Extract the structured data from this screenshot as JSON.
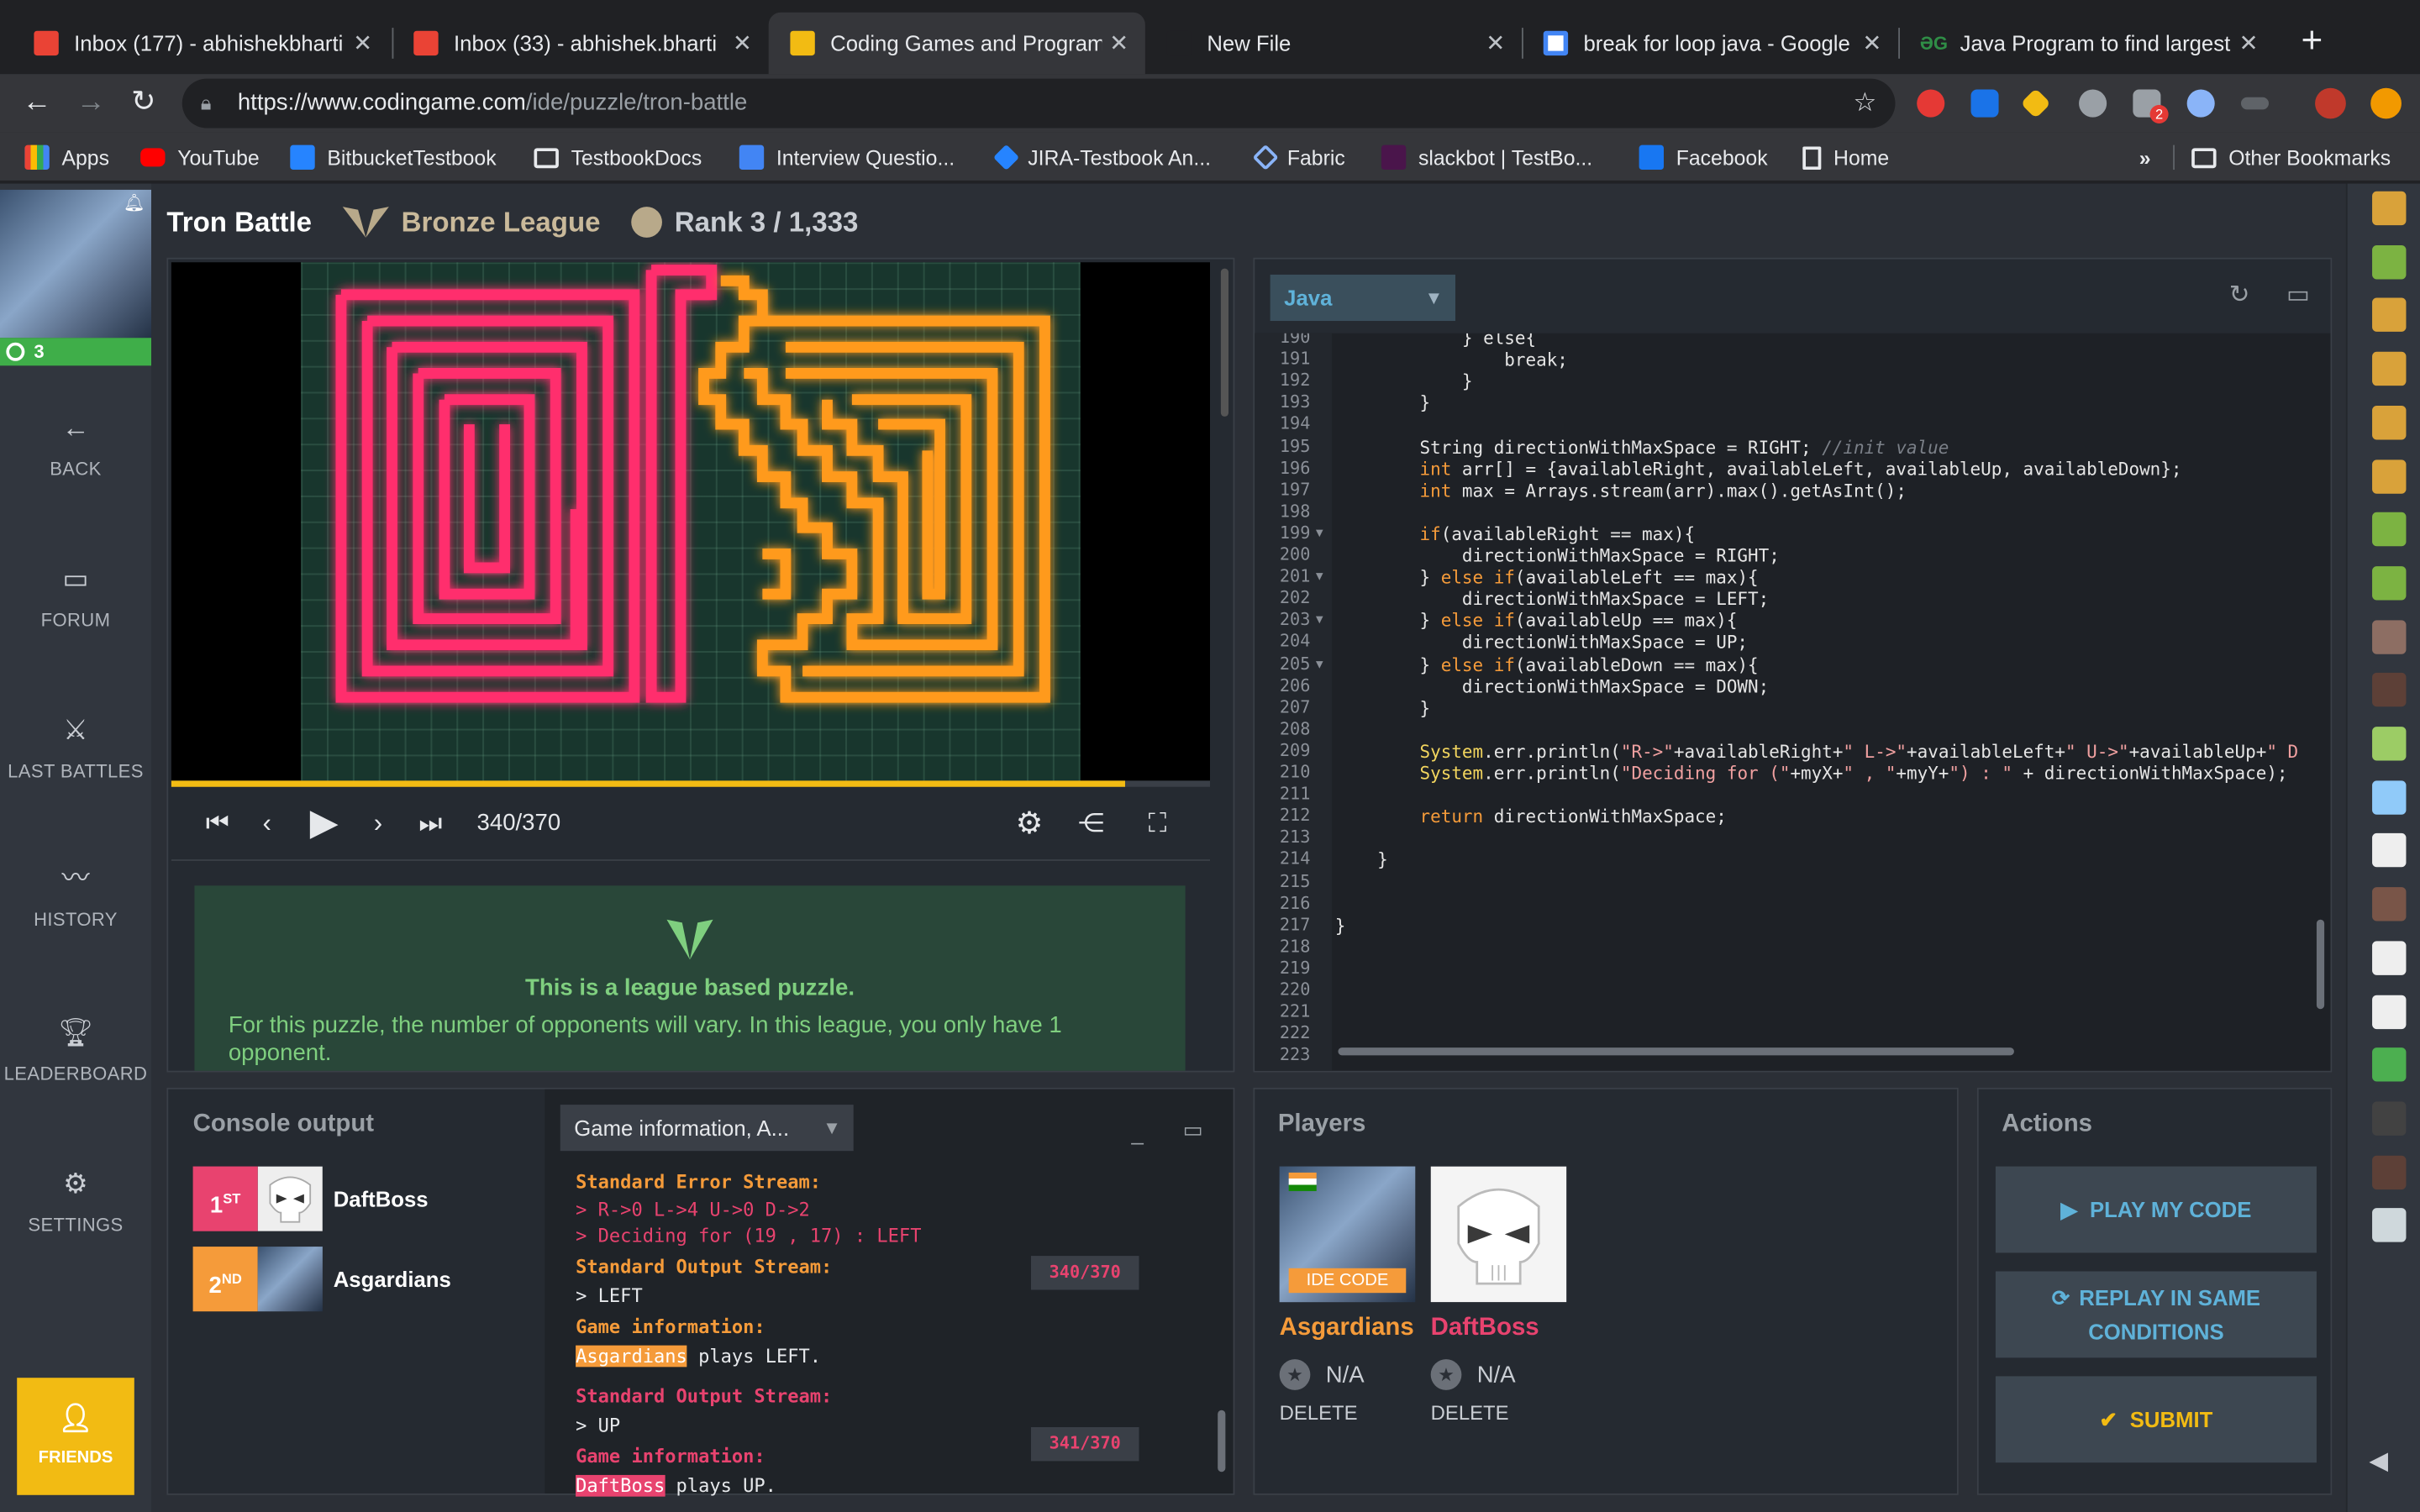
{
  "browser": {
    "tabs": [
      {
        "title": "Inbox (177) - abhishekbharti",
        "active": false,
        "icon": "gmail-icon"
      },
      {
        "title": "Inbox (33) - abhishek.bharti",
        "active": false,
        "icon": "gmail-icon"
      },
      {
        "title": "Coding Games and Programm",
        "active": true,
        "icon": "codingame-icon"
      },
      {
        "title": "New File",
        "active": false,
        "icon": "file-icon"
      },
      {
        "title": "break for loop java - Google",
        "active": false,
        "icon": "google-icon"
      },
      {
        "title": "Java Program to find largest",
        "active": false,
        "icon": "gfg-icon"
      }
    ],
    "url_host": "https://www.codingame.com",
    "url_path": "/ide/puzzle/tron-battle",
    "bookmarks": [
      "Apps",
      "YouTube",
      "BitbucketTestbook",
      "TestbookDocs",
      "Interview Questio...",
      "JIRA-Testbook An...",
      "Fabric",
      "slackbot | TestBo...",
      "Facebook",
      "Home"
    ],
    "more_bookmarks": "»",
    "other_bookmarks": "Other Bookmarks",
    "extension_badge": "2"
  },
  "nav": {
    "level": "3",
    "items": [
      "BACK",
      "FORUM",
      "LAST BATTLES",
      "HISTORY",
      "LEADERBOARD",
      "SETTINGS"
    ],
    "friends": "FRIENDS"
  },
  "header": {
    "title": "Tron Battle",
    "league": "Bronze League",
    "rank": "Rank 3 / 1,333"
  },
  "viewer": {
    "frame": "340/370",
    "progress": 0.919,
    "notice_title": "This is a league based puzzle.",
    "notice_text": "For this puzzle, the number of opponents will vary. In this league, you only have 1 opponent."
  },
  "editor": {
    "language": "Java",
    "line_numbers": [
      "190",
      "191",
      "192",
      "193",
      "194",
      "195",
      "196",
      "197",
      "198",
      "199",
      "200",
      "201",
      "202",
      "203",
      "204",
      "205",
      "206",
      "207",
      "208",
      "209",
      "210",
      "211",
      "212",
      "213",
      "214",
      "215",
      "216",
      "217",
      "218",
      "219",
      "220",
      "221",
      "222",
      "223"
    ],
    "folds": [
      "199",
      "201",
      "203",
      "205"
    ],
    "lines": [
      [
        [
          "white",
          "            } else{"
        ]
      ],
      [
        [
          "white",
          "                break;"
        ]
      ],
      [
        [
          "white",
          "            }"
        ]
      ],
      [
        [
          "white",
          "        }"
        ]
      ],
      [
        [
          "white",
          ""
        ]
      ],
      [
        [
          "white",
          "        String directionWithMaxSpace = RIGHT; "
        ],
        [
          "cm",
          "//init value"
        ]
      ],
      [
        [
          "kw",
          "        int"
        ],
        [
          "white",
          " arr[] = {availableRight, availableLeft, availableUp, availableDown};"
        ]
      ],
      [
        [
          "kw",
          "        int"
        ],
        [
          "white",
          " max = Arrays.stream(arr).max().getAsInt();"
        ]
      ],
      [
        [
          "white",
          ""
        ]
      ],
      [
        [
          "kw",
          "        if"
        ],
        [
          "white",
          "(availableRight == max){"
        ]
      ],
      [
        [
          "white",
          "            directionWithMaxSpace = RIGHT;"
        ]
      ],
      [
        [
          "white",
          "        } "
        ],
        [
          "kw",
          "else if"
        ],
        [
          "white",
          "(availableLeft == max){"
        ]
      ],
      [
        [
          "white",
          "            directionWithMaxSpace = LEFT;"
        ]
      ],
      [
        [
          "white",
          "        } "
        ],
        [
          "kw",
          "else if"
        ],
        [
          "white",
          "(availableUp == max){"
        ]
      ],
      [
        [
          "white",
          "            directionWithMaxSpace = UP;"
        ]
      ],
      [
        [
          "white",
          "        } "
        ],
        [
          "kw",
          "else if"
        ],
        [
          "white",
          "(availableDown == max){"
        ]
      ],
      [
        [
          "white",
          "            directionWithMaxSpace = DOWN;"
        ]
      ],
      [
        [
          "white",
          "        }"
        ]
      ],
      [
        [
          "white",
          ""
        ]
      ],
      [
        [
          "fn",
          "        System"
        ],
        [
          "white",
          ".err.println("
        ],
        [
          "str",
          "\"R->\""
        ],
        [
          "white",
          "+availableRight+"
        ],
        [
          "str",
          "\" L->\""
        ],
        [
          "white",
          "+availableLeft+"
        ],
        [
          "str",
          "\" U->\""
        ],
        [
          "white",
          "+availableUp+"
        ],
        [
          "str",
          "\" D"
        ]
      ],
      [
        [
          "fn",
          "        System"
        ],
        [
          "white",
          ".err.println("
        ],
        [
          "str",
          "\"Deciding for (\""
        ],
        [
          "white",
          "+myX+"
        ],
        [
          "str",
          "\" , \""
        ],
        [
          "white",
          "+myY+"
        ],
        [
          "str",
          "\") : \""
        ],
        [
          "white",
          " + directionWithMaxSpace);"
        ]
      ],
      [
        [
          "white",
          ""
        ]
      ],
      [
        [
          "kw",
          "        return"
        ],
        [
          "white",
          " directionWithMaxSpace;"
        ]
      ],
      [
        [
          "white",
          ""
        ]
      ],
      [
        [
          "white",
          "    }"
        ]
      ],
      [
        [
          "white",
          ""
        ]
      ],
      [
        [
          "white",
          ""
        ]
      ],
      [
        [
          "white",
          "}"
        ]
      ],
      [
        [
          "white",
          ""
        ]
      ],
      [
        [
          "white",
          ""
        ]
      ],
      [
        [
          "white",
          ""
        ]
      ],
      [
        [
          "white",
          ""
        ]
      ],
      [
        [
          "white",
          ""
        ]
      ],
      [
        [
          "white",
          ""
        ]
      ]
    ]
  },
  "console": {
    "title": "Console output",
    "ranking": [
      {
        "place": "1",
        "suffix": "ST",
        "name": "DaftBoss",
        "color": "#e8436f"
      },
      {
        "place": "2",
        "suffix": "ND",
        "name": "Asgardians",
        "color": "#f59b3a"
      }
    ],
    "dropdown": "Game information, A...",
    "log": {
      "err_header": "Standard Error Stream:",
      "err_line1": "> R->0 L->4 U->0 D->2",
      "err_line2": "> Deciding for (19 , 17) : LEFT",
      "out_header1": "Standard Output Stream:",
      "out_line1": "> LEFT",
      "info_header1": "Game information:",
      "info_player1": "Asgardians",
      "info_text1": " plays LEFT.",
      "turn1": "340/370",
      "out_header2": "Standard Output Stream:",
      "out_line2": "> UP",
      "info_header2": "Game information:",
      "info_player2": "DaftBoss",
      "info_text2": " plays UP.",
      "turn2": "341/370"
    }
  },
  "players": {
    "title": "Players",
    "list": [
      {
        "name": "Asgardians",
        "score": "N/A",
        "delete": "DELETE",
        "badge": "IDE CODE",
        "color": "#f59b3a"
      },
      {
        "name": "DaftBoss",
        "score": "N/A",
        "delete": "DELETE",
        "color": "#e8436f"
      }
    ]
  },
  "actions": {
    "title": "Actions",
    "play": "PLAY MY CODE",
    "replay": "REPLAY IN SAME CONDITIONS",
    "submit": "SUBMIT"
  },
  "colors": {
    "accent": "#f2bb13",
    "orange": "#f59b3a",
    "pink": "#e8436f",
    "link": "#5fb2d9"
  }
}
